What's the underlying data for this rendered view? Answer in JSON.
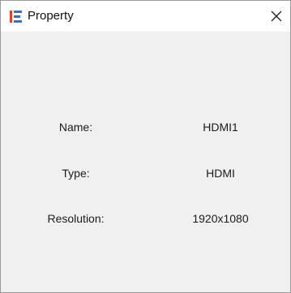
{
  "window": {
    "title": "Property",
    "close_icon": "close-icon",
    "app_icon": "app-logo-icon"
  },
  "properties": [
    {
      "label": "Name:",
      "value": "HDMI1"
    },
    {
      "label": "Type:",
      "value": "HDMI"
    },
    {
      "label": "Resolution:",
      "value": "1920x1080"
    }
  ],
  "colors": {
    "titlebar_bg": "#ffffff",
    "body_bg": "#f0f0f0",
    "icon_red": "#e8402a",
    "icon_blue": "#2f6fd6",
    "text": "#1a1a1a"
  }
}
